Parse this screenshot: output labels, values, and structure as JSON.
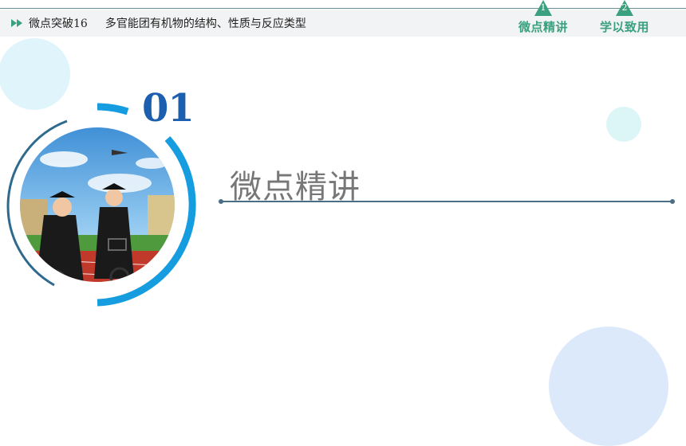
{
  "header": {
    "breadcrumb_code": "微点突破16",
    "breadcrumb_title": "多官能团有机物的结构、性质与反应类型"
  },
  "nav": {
    "tabs": [
      {
        "number": "1",
        "label": "微点精讲"
      },
      {
        "number": "2",
        "label": "学以致用"
      }
    ]
  },
  "section": {
    "number": "01",
    "title": "微点精讲"
  },
  "colors": {
    "accent_green": "#3aa07e",
    "section_blue": "#1c5fae",
    "ring_blue": "#169de0",
    "ring_dark": "#2d6a8e"
  },
  "image": {
    "description_icon": "graduation-photo"
  }
}
